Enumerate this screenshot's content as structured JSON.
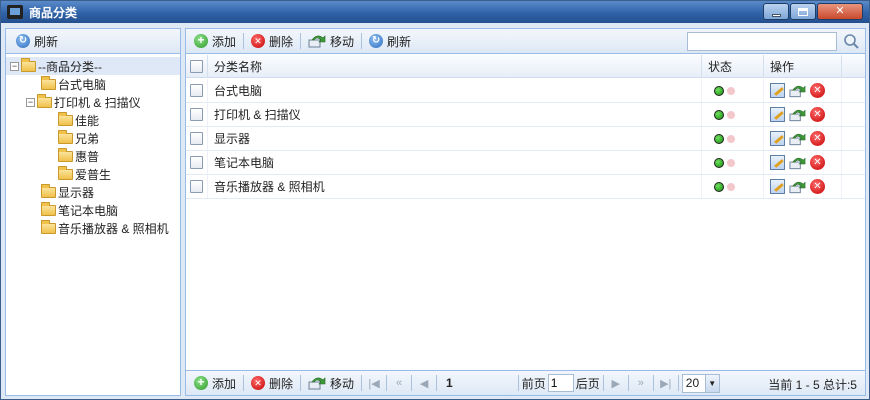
{
  "window": {
    "title": "商品分类"
  },
  "left": {
    "refresh_label": "刷新",
    "tree": [
      {
        "label": "--商品分类--",
        "level": 0,
        "toggle": "−",
        "selected": true
      },
      {
        "label": "台式电脑",
        "level": 1
      },
      {
        "label": "打印机 & 扫描仪",
        "level": 1,
        "toggle": "−"
      },
      {
        "label": "佳能",
        "level": 2
      },
      {
        "label": "兄弟",
        "level": 2
      },
      {
        "label": "惠普",
        "level": 2
      },
      {
        "label": "爱普生",
        "level": 2
      },
      {
        "label": "显示器",
        "level": 1
      },
      {
        "label": "笔记本电脑",
        "level": 1
      },
      {
        "label": "音乐播放器 & 照相机",
        "level": 1
      }
    ]
  },
  "toolbar": {
    "add_label": "添加",
    "delete_label": "删除",
    "move_label": "移动",
    "refresh_label": "刷新",
    "search_value": ""
  },
  "grid": {
    "headers": {
      "name": "分类名称",
      "status": "状态",
      "ops": "操作"
    },
    "rows": [
      {
        "name": "台式电脑"
      },
      {
        "name": "打印机 & 扫描仪"
      },
      {
        "name": "显示器"
      },
      {
        "name": "笔记本电脑"
      },
      {
        "name": "音乐播放器 & 照相机"
      }
    ]
  },
  "pager": {
    "add_label": "添加",
    "delete_label": "删除",
    "move_label": "移动",
    "current_page": "1",
    "prev_label": "前页",
    "page_input": "1",
    "next_label": "后页",
    "page_size": "20",
    "info": "当前 1 - 5 总计:5"
  },
  "colors": {
    "title_bar": "#2f63a8",
    "border": "#99bbe8",
    "status_on": "#1a8a10",
    "status_off": "#f3c7cc"
  }
}
